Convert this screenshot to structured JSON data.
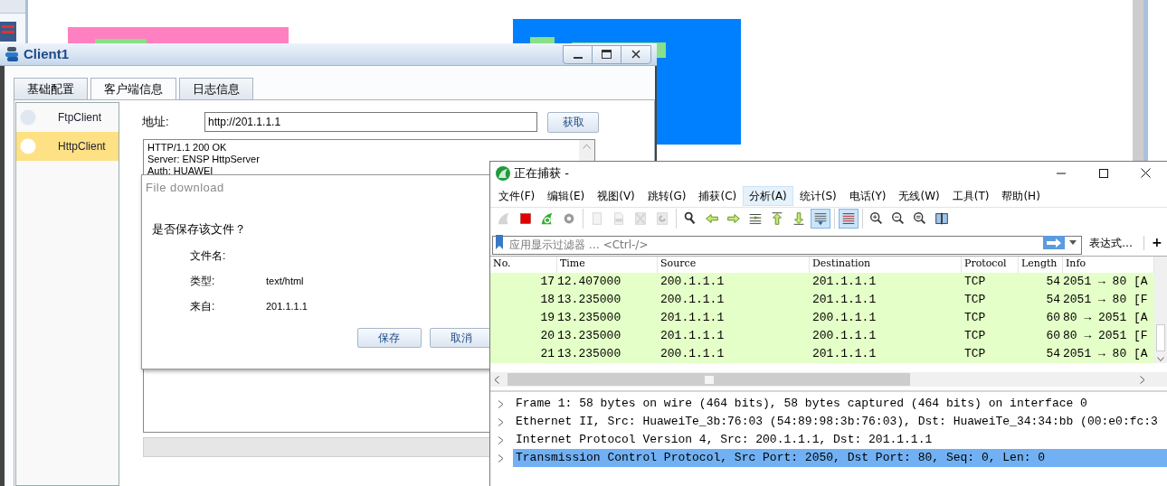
{
  "client_window": {
    "title": "Client1",
    "tabs": [
      {
        "label": "基础配置",
        "selected": false
      },
      {
        "label": "客户端信息",
        "selected": true
      },
      {
        "label": "日志信息",
        "selected": false
      }
    ],
    "clients": [
      {
        "label": "FtpClient",
        "selected": false
      },
      {
        "label": "HttpClient",
        "selected": true
      }
    ],
    "address": {
      "label": "地址:",
      "value": "http://201.1.1.1"
    },
    "fetch_button": "获取",
    "response_lines": [
      "HTTP/1.1 200 OK",
      "Server: ENSP HttpServer",
      "Auth: HUAWEI"
    ]
  },
  "download_dialog": {
    "title": "File download",
    "question": "是否保存该文件？",
    "fields": [
      {
        "label": "文件名:"
      },
      {
        "label": "类型:",
        "value": "text/html"
      },
      {
        "label": "来自:",
        "value": "201.1.1.1"
      }
    ],
    "buttons": [
      "保存",
      "取消"
    ]
  },
  "wireshark": {
    "title": "正在捕获 -",
    "menu": [
      {
        "label": "文件(F)",
        "selected": false
      },
      {
        "label": "编辑(E)",
        "selected": false
      },
      {
        "label": "视图(V)",
        "selected": false
      },
      {
        "label": "跳转(G)",
        "selected": false
      },
      {
        "label": "捕获(C)",
        "selected": false
      },
      {
        "label": "分析(A)",
        "selected": true
      },
      {
        "label": "统计(S)",
        "selected": false
      },
      {
        "label": "电话(Y)",
        "selected": false
      },
      {
        "label": "无线(W)",
        "selected": false
      },
      {
        "label": "工具(T)",
        "selected": false
      },
      {
        "label": "帮助(H)",
        "selected": false
      }
    ],
    "toolbar_groups": [
      [
        {
          "kind": "start",
          "disabled": true,
          "pressed": false
        },
        {
          "kind": "stop",
          "disabled": false,
          "pressed": false
        },
        {
          "kind": "restart",
          "disabled": false,
          "pressed": false
        },
        {
          "kind": "options",
          "disabled": false,
          "pressed": false
        }
      ],
      [
        {
          "kind": "open",
          "disabled": true,
          "pressed": false
        },
        {
          "kind": "save",
          "disabled": true,
          "pressed": false
        },
        {
          "kind": "close",
          "disabled": true,
          "pressed": false
        },
        {
          "kind": "reload",
          "disabled": true,
          "pressed": false
        }
      ],
      [
        {
          "kind": "find",
          "disabled": false,
          "pressed": false
        },
        {
          "kind": "back",
          "disabled": false,
          "pressed": false
        },
        {
          "kind": "forward",
          "disabled": false,
          "pressed": false
        },
        {
          "kind": "goto",
          "disabled": false,
          "pressed": false
        },
        {
          "kind": "first",
          "disabled": false,
          "pressed": false
        },
        {
          "kind": "last",
          "disabled": false,
          "pressed": false
        },
        {
          "kind": "autoscroll",
          "disabled": false,
          "pressed": true
        }
      ],
      [
        {
          "kind": "colorize",
          "disabled": false,
          "pressed": true
        }
      ],
      [
        {
          "kind": "zoom-in",
          "disabled": false,
          "pressed": false
        },
        {
          "kind": "zoom-out",
          "disabled": false,
          "pressed": false
        },
        {
          "kind": "zoom-normal",
          "disabled": false,
          "pressed": false
        },
        {
          "kind": "resize",
          "disabled": false,
          "pressed": false
        }
      ]
    ],
    "filter": {
      "placeholder": "应用显示过滤器 … <Ctrl-/>"
    },
    "expression_button": "表达式…",
    "add_button": "+",
    "columns": [
      "No.",
      "Time",
      "Source",
      "Destination",
      "Protocol",
      "Length",
      "Info"
    ],
    "packets": [
      {
        "no": "17",
        "time": "12.407000",
        "source": "200.1.1.1",
        "destination": "201.1.1.1",
        "protocol": "TCP",
        "length": "54",
        "info": "2051 → 80 [A"
      },
      {
        "no": "18",
        "time": "13.235000",
        "source": "200.1.1.1",
        "destination": "201.1.1.1",
        "protocol": "TCP",
        "length": "54",
        "info": "2051 → 80 [F"
      },
      {
        "no": "19",
        "time": "13.235000",
        "source": "201.1.1.1",
        "destination": "200.1.1.1",
        "protocol": "TCP",
        "length": "60",
        "info": "80 → 2051 [A"
      },
      {
        "no": "20",
        "time": "13.235000",
        "source": "201.1.1.1",
        "destination": "200.1.1.1",
        "protocol": "TCP",
        "length": "60",
        "info": "80 → 2051 [F"
      },
      {
        "no": "21",
        "time": "13.235000",
        "source": "200.1.1.1",
        "destination": "201.1.1.1",
        "protocol": "TCP",
        "length": "54",
        "info": "2051 → 80 [A"
      }
    ],
    "details": [
      {
        "text": "Frame 1: 58 bytes on wire (464 bits), 58 bytes captured (464 bits) on interface 0",
        "expanded": false,
        "selected": false
      },
      {
        "text": "Ethernet II, Src: HuaweiTe_3b:76:03 (54:89:98:3b:76:03), Dst: HuaweiTe_34:34:bb (00:e0:fc:3",
        "expanded": false,
        "selected": false
      },
      {
        "text": "Internet Protocol Version 4, Src: 200.1.1.1, Dst: 201.1.1.1",
        "expanded": false,
        "selected": false
      },
      {
        "text": "Transmission Control Protocol, Src Port: 2050, Dst Port: 80, Seq: 0, Len: 0",
        "expanded": false,
        "selected": true
      }
    ]
  }
}
